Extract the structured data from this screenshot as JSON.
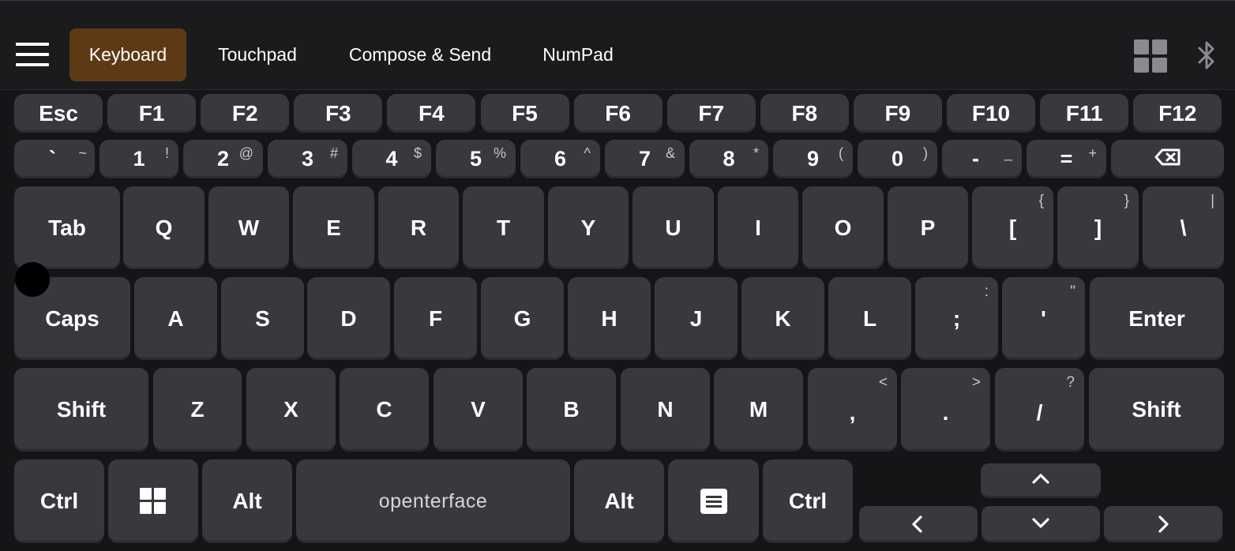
{
  "topbar": {
    "tabs": [
      {
        "label": "Keyboard",
        "active": true
      },
      {
        "label": "Touchpad",
        "active": false
      },
      {
        "label": "Compose & Send",
        "active": false
      },
      {
        "label": "NumPad",
        "active": false
      }
    ],
    "icons": [
      "menu-icon",
      "grid-view-icon",
      "bluetooth-icon"
    ],
    "active_tab_color": "#5e3a14"
  },
  "keyboard": {
    "function_row": [
      "Esc",
      "F1",
      "F2",
      "F3",
      "F4",
      "F5",
      "F6",
      "F7",
      "F8",
      "F9",
      "F10",
      "F11",
      "F12"
    ],
    "number_row": [
      {
        "main": "`",
        "shift": "~"
      },
      {
        "main": "1",
        "shift": "!"
      },
      {
        "main": "2",
        "shift": "@"
      },
      {
        "main": "3",
        "shift": "#"
      },
      {
        "main": "4",
        "shift": "$"
      },
      {
        "main": "5",
        "shift": "%"
      },
      {
        "main": "6",
        "shift": "^"
      },
      {
        "main": "7",
        "shift": "&"
      },
      {
        "main": "8",
        "shift": "*"
      },
      {
        "main": "9",
        "shift": "("
      },
      {
        "main": "0",
        "shift": ")"
      },
      {
        "main": "-",
        "shift": "_"
      },
      {
        "main": "=",
        "shift": "+"
      },
      {
        "main": "",
        "shift": "",
        "icon": "backspace-icon"
      }
    ],
    "top_row": [
      {
        "main": "Tab",
        "shift": ""
      },
      {
        "main": "Q",
        "shift": ""
      },
      {
        "main": "W",
        "shift": ""
      },
      {
        "main": "E",
        "shift": ""
      },
      {
        "main": "R",
        "shift": ""
      },
      {
        "main": "T",
        "shift": ""
      },
      {
        "main": "Y",
        "shift": ""
      },
      {
        "main": "U",
        "shift": ""
      },
      {
        "main": "I",
        "shift": ""
      },
      {
        "main": "O",
        "shift": ""
      },
      {
        "main": "P",
        "shift": ""
      },
      {
        "main": "[",
        "shift": "{"
      },
      {
        "main": "]",
        "shift": "}"
      },
      {
        "main": "\\",
        "shift": "|"
      }
    ],
    "home_row": [
      {
        "main": "Caps",
        "shift": ""
      },
      {
        "main": "A",
        "shift": ""
      },
      {
        "main": "S",
        "shift": ""
      },
      {
        "main": "D",
        "shift": ""
      },
      {
        "main": "F",
        "shift": ""
      },
      {
        "main": "G",
        "shift": ""
      },
      {
        "main": "H",
        "shift": ""
      },
      {
        "main": "J",
        "shift": ""
      },
      {
        "main": "K",
        "shift": ""
      },
      {
        "main": "L",
        "shift": ""
      },
      {
        "main": ";",
        "shift": ":"
      },
      {
        "main": "'",
        "shift": "\""
      },
      {
        "main": "Enter",
        "shift": ""
      }
    ],
    "shift_row": [
      {
        "main": "Shift",
        "shift": ""
      },
      {
        "main": "Z",
        "shift": ""
      },
      {
        "main": "X",
        "shift": ""
      },
      {
        "main": "C",
        "shift": ""
      },
      {
        "main": "V",
        "shift": ""
      },
      {
        "main": "B",
        "shift": ""
      },
      {
        "main": "N",
        "shift": ""
      },
      {
        "main": "M",
        "shift": ""
      },
      {
        "main": ",",
        "shift": "<"
      },
      {
        "main": ".",
        "shift": ">"
      },
      {
        "main": "/",
        "shift": "?"
      },
      {
        "main": "Shift",
        "shift": ""
      }
    ],
    "bottom_row": [
      {
        "main": "Ctrl"
      },
      {
        "main": "",
        "icon": "windows-icon"
      },
      {
        "main": "Alt"
      },
      {
        "main": "openterface"
      },
      {
        "main": "Alt"
      },
      {
        "main": "",
        "icon": "context-menu-icon"
      },
      {
        "main": "Ctrl"
      }
    ],
    "arrows": [
      "arrow-up-icon",
      "arrow-left-icon",
      "arrow-down-icon",
      "arrow-right-icon"
    ],
    "key_color": "#38383d",
    "background_color": "#151518"
  }
}
